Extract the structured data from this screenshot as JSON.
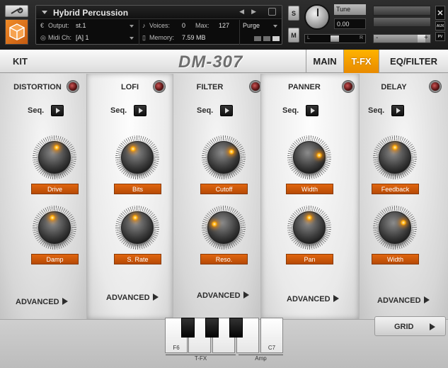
{
  "header": {
    "instrument_title": "Hybrid Percussion",
    "output_label": "Output:",
    "output_value": "st.1",
    "midi_label": "Midi Ch:",
    "midi_value": "[A] 1",
    "voices_label": "Voices:",
    "voices_value": "0",
    "max_label": "Max:",
    "max_value": "127",
    "memory_label": "Memory:",
    "memory_value": "7.59 MB",
    "purge_label": "Purge",
    "solo_label": "S",
    "mute_label": "M",
    "tune_label": "Tune",
    "tune_value": "0.00",
    "pan_left": "L",
    "pan_right": "R",
    "aux_label": "AUX",
    "pv_label": "PV",
    "vol_minus": "-",
    "vol_plus": "+"
  },
  "topbar": {
    "kit_label": "KIT",
    "product_name": "DM-307",
    "tabs": [
      {
        "label": "MAIN",
        "active": false
      },
      {
        "label": "T-FX",
        "active": true
      },
      {
        "label": "EQ/FILTER",
        "active": false
      }
    ]
  },
  "modules": [
    {
      "title": "DISTORTION",
      "seq": "Seq.",
      "knob1": "Drive",
      "knob2": "Damp",
      "advanced": "ADVANCED"
    },
    {
      "title": "LOFI",
      "seq": "Seq.",
      "knob1": "Bits",
      "knob2": "S. Rate",
      "advanced": "ADVANCED"
    },
    {
      "title": "FILTER",
      "seq": "Seq.",
      "knob1": "Cutoff",
      "knob2": "Reso.",
      "advanced": "ADVANCED"
    },
    {
      "title": "PANNER",
      "seq": "Seq.",
      "knob1": "Width",
      "knob2": "Pan",
      "advanced": "ADVANCED"
    },
    {
      "title": "DELAY",
      "seq": "Seq.",
      "knob1": "Feedback",
      "knob2": "Width",
      "advanced": "ADVANCED"
    }
  ],
  "knob_levels": [
    [
      0.55,
      0.45
    ],
    [
      0.4,
      0.45
    ],
    [
      0.7,
      0.25
    ],
    [
      0.78,
      0.5
    ],
    [
      0.5,
      0.72
    ]
  ],
  "footer": {
    "grid_label": "GRID",
    "key_f6": "F6",
    "key_c7": "C7",
    "range_tfx": "T-FX",
    "range_amp": "Amp"
  },
  "colors": {
    "accent": "#f5a000",
    "param_label": "#d35a0a"
  }
}
